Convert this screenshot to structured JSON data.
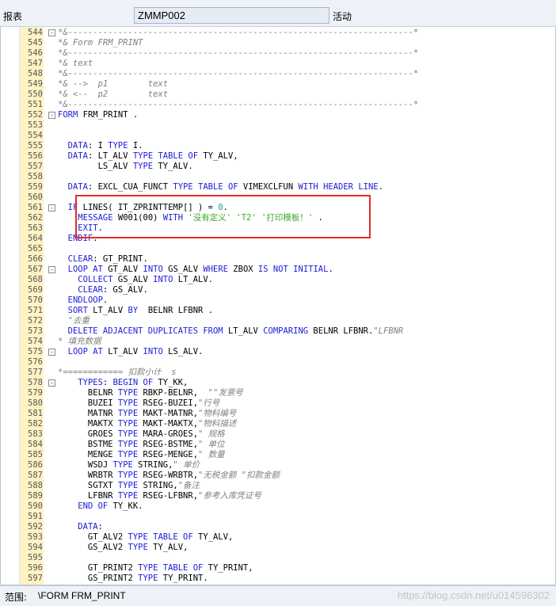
{
  "header": {
    "report_label": "报表",
    "program_name": "ZMMP002",
    "status_label": "活动"
  },
  "status": {
    "scope_label": "范围:",
    "scope_value": "\\FORM FRM_PRINT",
    "watermark": "https://blog.csdn.net/u014596302"
  },
  "code_lines": [
    {
      "n": "544",
      "fold": "-",
      "segs": [
        [
          "cm",
          "*&---------------------------------------------------------------------*"
        ]
      ]
    },
    {
      "n": "545",
      "segs": [
        [
          "cm",
          "*& Form FRM_PRINT"
        ]
      ]
    },
    {
      "n": "546",
      "segs": [
        [
          "cm",
          "*&---------------------------------------------------------------------*"
        ]
      ]
    },
    {
      "n": "547",
      "segs": [
        [
          "cm",
          "*& text"
        ]
      ]
    },
    {
      "n": "548",
      "segs": [
        [
          "cm",
          "*&---------------------------------------------------------------------*"
        ]
      ]
    },
    {
      "n": "549",
      "segs": [
        [
          "cm",
          "*& -->  p1        text"
        ]
      ]
    },
    {
      "n": "550",
      "segs": [
        [
          "cm",
          "*& <--  p2        text"
        ]
      ]
    },
    {
      "n": "551",
      "segs": [
        [
          "cm",
          "*&---------------------------------------------------------------------*"
        ]
      ]
    },
    {
      "n": "552",
      "fold": "-",
      "segs": [
        [
          "kw",
          "FORM"
        ],
        [
          "txt",
          " FRM_PRINT ."
        ]
      ]
    },
    {
      "n": "553",
      "segs": []
    },
    {
      "n": "554",
      "segs": []
    },
    {
      "n": "555",
      "segs": [
        [
          "txt",
          "  "
        ],
        [
          "kw",
          "DATA"
        ],
        [
          "txt",
          ": I "
        ],
        [
          "kw",
          "TYPE"
        ],
        [
          "txt",
          " I."
        ]
      ]
    },
    {
      "n": "556",
      "segs": [
        [
          "txt",
          "  "
        ],
        [
          "kw",
          "DATA"
        ],
        [
          "txt",
          ": LT_ALV "
        ],
        [
          "kw",
          "TYPE TABLE OF"
        ],
        [
          "txt",
          " TY_ALV,"
        ]
      ]
    },
    {
      "n": "557",
      "segs": [
        [
          "txt",
          "        LS_ALV "
        ],
        [
          "kw",
          "TYPE"
        ],
        [
          "txt",
          " TY_ALV."
        ]
      ]
    },
    {
      "n": "558",
      "segs": []
    },
    {
      "n": "559",
      "segs": [
        [
          "txt",
          "  "
        ],
        [
          "kw",
          "DATA"
        ],
        [
          "txt",
          ": EXCL_CUA_FUNCT "
        ],
        [
          "kw",
          "TYPE TABLE OF"
        ],
        [
          "txt",
          " VIMEXCLFUN "
        ],
        [
          "kw",
          "WITH HEADER LINE"
        ],
        [
          "txt",
          "."
        ]
      ]
    },
    {
      "n": "560",
      "segs": []
    },
    {
      "n": "561",
      "fold": "-",
      "segs": [
        [
          "txt",
          "  "
        ],
        [
          "kw",
          "IF"
        ],
        [
          "txt",
          " LINES( IT_ZPRINTTEMP[] ) = "
        ],
        [
          "num",
          "0"
        ],
        [
          "txt",
          "."
        ]
      ]
    },
    {
      "n": "562",
      "segs": [
        [
          "txt",
          "    "
        ],
        [
          "kw",
          "MESSAGE"
        ],
        [
          "txt",
          " W001(00) "
        ],
        [
          "kw",
          "WITH"
        ],
        [
          "txt",
          " "
        ],
        [
          "str",
          "'没有定义'"
        ],
        [
          "txt",
          " "
        ],
        [
          "str",
          "'T2'"
        ],
        [
          "txt",
          " "
        ],
        [
          "str",
          "'打印模板！'"
        ],
        [
          "txt",
          " ."
        ]
      ]
    },
    {
      "n": "563",
      "segs": [
        [
          "txt",
          "    "
        ],
        [
          "kw",
          "EXIT"
        ],
        [
          "txt",
          "."
        ]
      ]
    },
    {
      "n": "564",
      "segs": [
        [
          "txt",
          "  "
        ],
        [
          "kw",
          "ENDIF"
        ],
        [
          "txt",
          "."
        ]
      ]
    },
    {
      "n": "565",
      "segs": []
    },
    {
      "n": "566",
      "segs": [
        [
          "txt",
          "  "
        ],
        [
          "kw",
          "CLEAR"
        ],
        [
          "txt",
          ": GT_PRINT."
        ]
      ]
    },
    {
      "n": "567",
      "fold": "-",
      "segs": [
        [
          "txt",
          "  "
        ],
        [
          "kw",
          "LOOP AT"
        ],
        [
          "txt",
          " GT_ALV "
        ],
        [
          "kw",
          "INTO"
        ],
        [
          "txt",
          " GS_ALV "
        ],
        [
          "kw",
          "WHERE"
        ],
        [
          "txt",
          " ZBOX "
        ],
        [
          "kw",
          "IS NOT INITIAL"
        ],
        [
          "txt",
          "."
        ]
      ]
    },
    {
      "n": "568",
      "segs": [
        [
          "txt",
          "    "
        ],
        [
          "kw",
          "COLLECT"
        ],
        [
          "txt",
          " GS_ALV "
        ],
        [
          "kw",
          "INTO"
        ],
        [
          "txt",
          " LT_ALV."
        ]
      ]
    },
    {
      "n": "569",
      "segs": [
        [
          "txt",
          "    "
        ],
        [
          "kw",
          "CLEAR"
        ],
        [
          "txt",
          ": GS_ALV."
        ]
      ]
    },
    {
      "n": "570",
      "segs": [
        [
          "txt",
          "  "
        ],
        [
          "kw",
          "ENDLOOP"
        ],
        [
          "txt",
          "."
        ]
      ]
    },
    {
      "n": "571",
      "segs": [
        [
          "txt",
          "  "
        ],
        [
          "kw",
          "SORT"
        ],
        [
          "txt",
          " LT_ALV "
        ],
        [
          "kw",
          "BY"
        ],
        [
          "txt",
          "  BELNR LFBNR ."
        ]
      ]
    },
    {
      "n": "572",
      "segs": [
        [
          "txt",
          "  "
        ],
        [
          "cm",
          "\"去重"
        ]
      ]
    },
    {
      "n": "573",
      "segs": [
        [
          "txt",
          "  "
        ],
        [
          "kw",
          "DELETE ADJACENT DUPLICATES FROM"
        ],
        [
          "txt",
          " LT_ALV "
        ],
        [
          "kw",
          "COMPARING"
        ],
        [
          "txt",
          " BELNR LFBNR."
        ],
        [
          "cm",
          "\"LFBNR"
        ]
      ]
    },
    {
      "n": "574",
      "segs": [
        [
          "cm",
          "* 填充数据"
        ]
      ]
    },
    {
      "n": "575",
      "fold": "-",
      "segs": [
        [
          "txt",
          "  "
        ],
        [
          "kw",
          "LOOP AT"
        ],
        [
          "txt",
          " LT_ALV "
        ],
        [
          "kw",
          "INTO"
        ],
        [
          "txt",
          " LS_ALV."
        ]
      ]
    },
    {
      "n": "576",
      "segs": []
    },
    {
      "n": "577",
      "segs": [
        [
          "cm",
          "*============ 扣款小计  s"
        ]
      ]
    },
    {
      "n": "578",
      "fold": "-",
      "segs": [
        [
          "txt",
          "    "
        ],
        [
          "kw",
          "TYPES"
        ],
        [
          "txt",
          ": "
        ],
        [
          "kw",
          "BEGIN OF"
        ],
        [
          "txt",
          " TY_KK,"
        ]
      ]
    },
    {
      "n": "579",
      "segs": [
        [
          "txt",
          "      BELNR "
        ],
        [
          "kw",
          "TYPE"
        ],
        [
          "txt",
          " RBKP-BELNR,  "
        ],
        [
          "cm",
          "\"\"发票号"
        ]
      ]
    },
    {
      "n": "580",
      "segs": [
        [
          "txt",
          "      BUZEI "
        ],
        [
          "kw",
          "TYPE"
        ],
        [
          "txt",
          " RSEG-BUZEI,"
        ],
        [
          "cm",
          "\"行号"
        ]
      ]
    },
    {
      "n": "581",
      "segs": [
        [
          "txt",
          "      MATNR "
        ],
        [
          "kw",
          "TYPE"
        ],
        [
          "txt",
          " MAKT-MATNR,"
        ],
        [
          "cm",
          "\"物料编号"
        ]
      ]
    },
    {
      "n": "582",
      "segs": [
        [
          "txt",
          "      MAKTX "
        ],
        [
          "kw",
          "TYPE"
        ],
        [
          "txt",
          " MAKT-MAKTX,"
        ],
        [
          "cm",
          "\"物料描述"
        ]
      ]
    },
    {
      "n": "583",
      "segs": [
        [
          "txt",
          "      GROES "
        ],
        [
          "kw",
          "TYPE"
        ],
        [
          "txt",
          " MARA-GROES,"
        ],
        [
          "cm",
          "\" 规格"
        ]
      ]
    },
    {
      "n": "584",
      "segs": [
        [
          "txt",
          "      BSTME "
        ],
        [
          "kw",
          "TYPE"
        ],
        [
          "txt",
          " RSEG-BSTME,"
        ],
        [
          "cm",
          "\" 单位"
        ]
      ]
    },
    {
      "n": "585",
      "segs": [
        [
          "txt",
          "      MENGE "
        ],
        [
          "kw",
          "TYPE"
        ],
        [
          "txt",
          " RSEG-MENGE,"
        ],
        [
          "cm",
          "\" 数量"
        ]
      ]
    },
    {
      "n": "586",
      "segs": [
        [
          "txt",
          "      WSDJ "
        ],
        [
          "kw",
          "TYPE"
        ],
        [
          "txt",
          " STRING,"
        ],
        [
          "cm",
          "\" 单价"
        ]
      ]
    },
    {
      "n": "587",
      "segs": [
        [
          "txt",
          "      WRBTR "
        ],
        [
          "kw",
          "TYPE"
        ],
        [
          "txt",
          " RSEG-WRBTR,"
        ],
        [
          "cm",
          "\"无税金额 \"扣款金额"
        ]
      ]
    },
    {
      "n": "588",
      "segs": [
        [
          "txt",
          "      SGTXT "
        ],
        [
          "kw",
          "TYPE"
        ],
        [
          "txt",
          " STRING,"
        ],
        [
          "cm",
          "\"备注"
        ]
      ]
    },
    {
      "n": "589",
      "segs": [
        [
          "txt",
          "      LFBNR "
        ],
        [
          "kw",
          "TYPE"
        ],
        [
          "txt",
          " RSEG-LFBNR,"
        ],
        [
          "cm",
          "\"参考入库凭证号"
        ]
      ]
    },
    {
      "n": "590",
      "segs": [
        [
          "txt",
          "    "
        ],
        [
          "kw",
          "END OF"
        ],
        [
          "txt",
          " TY_KK."
        ]
      ]
    },
    {
      "n": "591",
      "segs": []
    },
    {
      "n": "592",
      "segs": [
        [
          "txt",
          "    "
        ],
        [
          "kw",
          "DATA"
        ],
        [
          "txt",
          ":"
        ]
      ]
    },
    {
      "n": "593",
      "segs": [
        [
          "txt",
          "      GT_ALV2 "
        ],
        [
          "kw",
          "TYPE TABLE OF"
        ],
        [
          "txt",
          " TY_ALV,"
        ]
      ]
    },
    {
      "n": "594",
      "segs": [
        [
          "txt",
          "      GS_ALV2 "
        ],
        [
          "kw",
          "TYPE"
        ],
        [
          "txt",
          " TY_ALV,"
        ]
      ]
    },
    {
      "n": "595",
      "segs": []
    },
    {
      "n": "596",
      "segs": [
        [
          "txt",
          "      GT_PRINT2 "
        ],
        [
          "kw",
          "TYPE TABLE OF"
        ],
        [
          "txt",
          " TY_PRINT,"
        ]
      ]
    },
    {
      "n": "597",
      "segs": [
        [
          "txt",
          "      GS_PRINT2 "
        ],
        [
          "kw",
          "TYPE"
        ],
        [
          "txt",
          " TY_PRINT."
        ]
      ]
    }
  ]
}
